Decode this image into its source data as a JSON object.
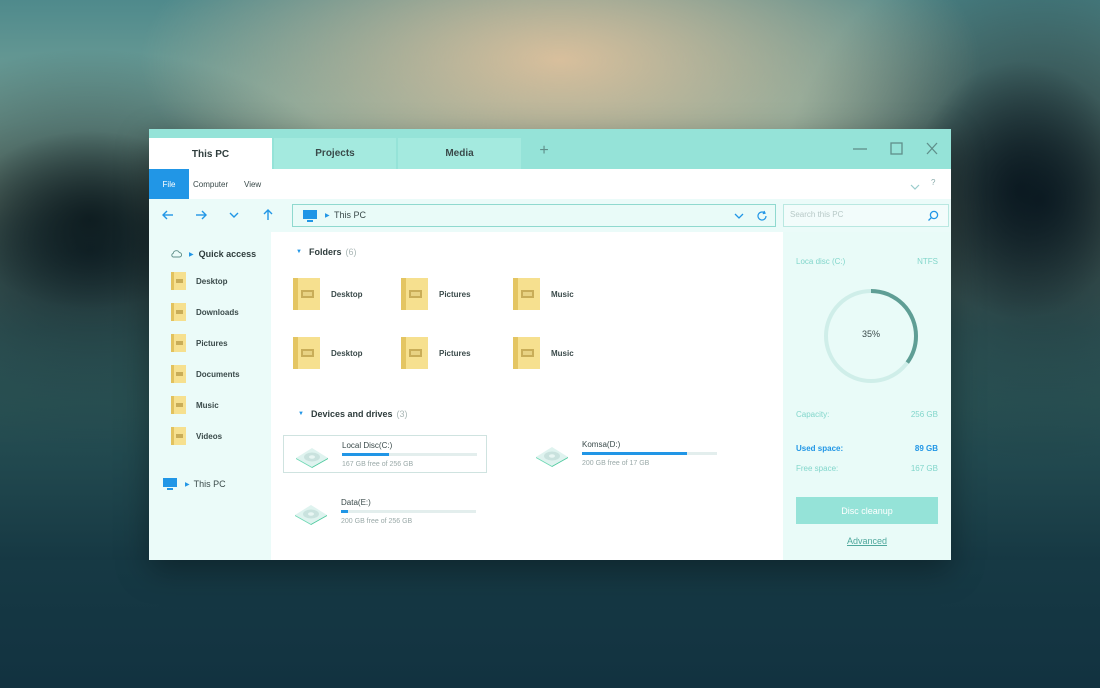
{
  "window": {
    "tabs": [
      {
        "label": "This PC",
        "active": true
      },
      {
        "label": "Projects",
        "active": false
      },
      {
        "label": "Media",
        "active": false
      }
    ],
    "add_tab_label": "+",
    "controls": {
      "minimize": "minimize-icon",
      "maximize": "maximize-icon",
      "close": "close-icon"
    }
  },
  "ribbon": {
    "file_label": "File",
    "computer_label": "Computer",
    "view_label": "View",
    "help_label": "?"
  },
  "address": {
    "path": "This PC",
    "search_placeholder": "Search this PC"
  },
  "nav": {
    "quick_access_label": "Quick access",
    "items": [
      {
        "label": "Desktop"
      },
      {
        "label": "Downloads"
      },
      {
        "label": "Pictures"
      },
      {
        "label": "Documents"
      },
      {
        "label": "Music"
      },
      {
        "label": "Videos"
      }
    ],
    "this_pc_label": "This PC"
  },
  "content": {
    "folders_title": "Folders",
    "folders_count": "(6)",
    "folders": [
      {
        "label": "Desktop"
      },
      {
        "label": "Pictures"
      },
      {
        "label": "Music"
      },
      {
        "label": "Desktop"
      },
      {
        "label": "Pictures"
      },
      {
        "label": "Music"
      }
    ],
    "drives_title": "Devices and drives",
    "drives_count": "(3)",
    "drives": [
      {
        "name": "Local Disc(C:)",
        "free_text": "167 GB free of 256 GB",
        "used_fraction": 0.35
      },
      {
        "name": "Komsa(D:)",
        "free_text": "200 GB free of 17 GB",
        "used_fraction": 0.78
      },
      {
        "name": "Data(E:)",
        "free_text": "200 GB free of 256 GB",
        "used_fraction": 0.05
      }
    ]
  },
  "details": {
    "disc_label": "Loca disc (C:)",
    "filesystem": "NTFS",
    "used_percent_text": "35%",
    "used_fraction": 0.35,
    "capacity_label": "Capacity:",
    "capacity_value": "256 GB",
    "used_label": "Used space:",
    "used_value": "89 GB",
    "free_label": "Free space:",
    "free_value": "167 GB",
    "cleanup_label": "Disc cleanup",
    "advanced_label": "Advanced"
  },
  "colors": {
    "accent_blue": "#2196e6",
    "mint": "#95e3d8",
    "folder_yellow": "#f6e08f"
  }
}
